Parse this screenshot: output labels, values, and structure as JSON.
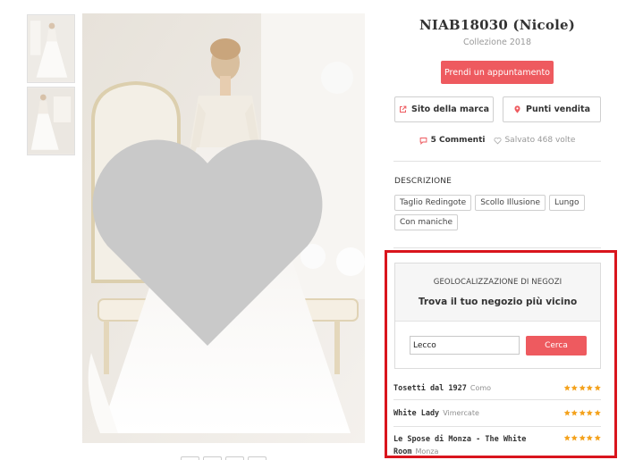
{
  "product": {
    "title": "NIAB18030 (Nicole)",
    "collection": "Collezione 2018",
    "appointment_button": "Prendi un appuntamento",
    "brand_site_button": "Sito della marca",
    "stores_button": "Punti vendita",
    "comments": "5 Commenti",
    "saved": "Salvato 468 volte"
  },
  "description": {
    "title": "DESCRIZIONE",
    "tags": [
      "Taglio Redingote",
      "Scollo Illusione",
      "Lungo",
      "Con maniche"
    ]
  },
  "geo": {
    "label": "GEOLOCALIZZAZIONE DI NEGOZI",
    "title": "Trova il tuo negozio più vicino",
    "input_value": "Lecco",
    "search_button": "Cerca"
  },
  "stores": [
    {
      "name": "Tosetti dal 1927",
      "city": "Como",
      "rating": 5
    },
    {
      "name": "White Lady",
      "city": "Vimercate",
      "rating": 5
    },
    {
      "name": "Le Spose di Monza - The White Room",
      "city": "Monza",
      "rating": 5
    }
  ],
  "colors": {
    "accent": "#ee5a5f",
    "highlight": "#d9151d",
    "star": "#f4a21d"
  },
  "icons": [
    "heart-icon",
    "external-link-icon",
    "map-pin-icon",
    "comment-icon",
    "heart-outline-icon",
    "star-icon"
  ]
}
